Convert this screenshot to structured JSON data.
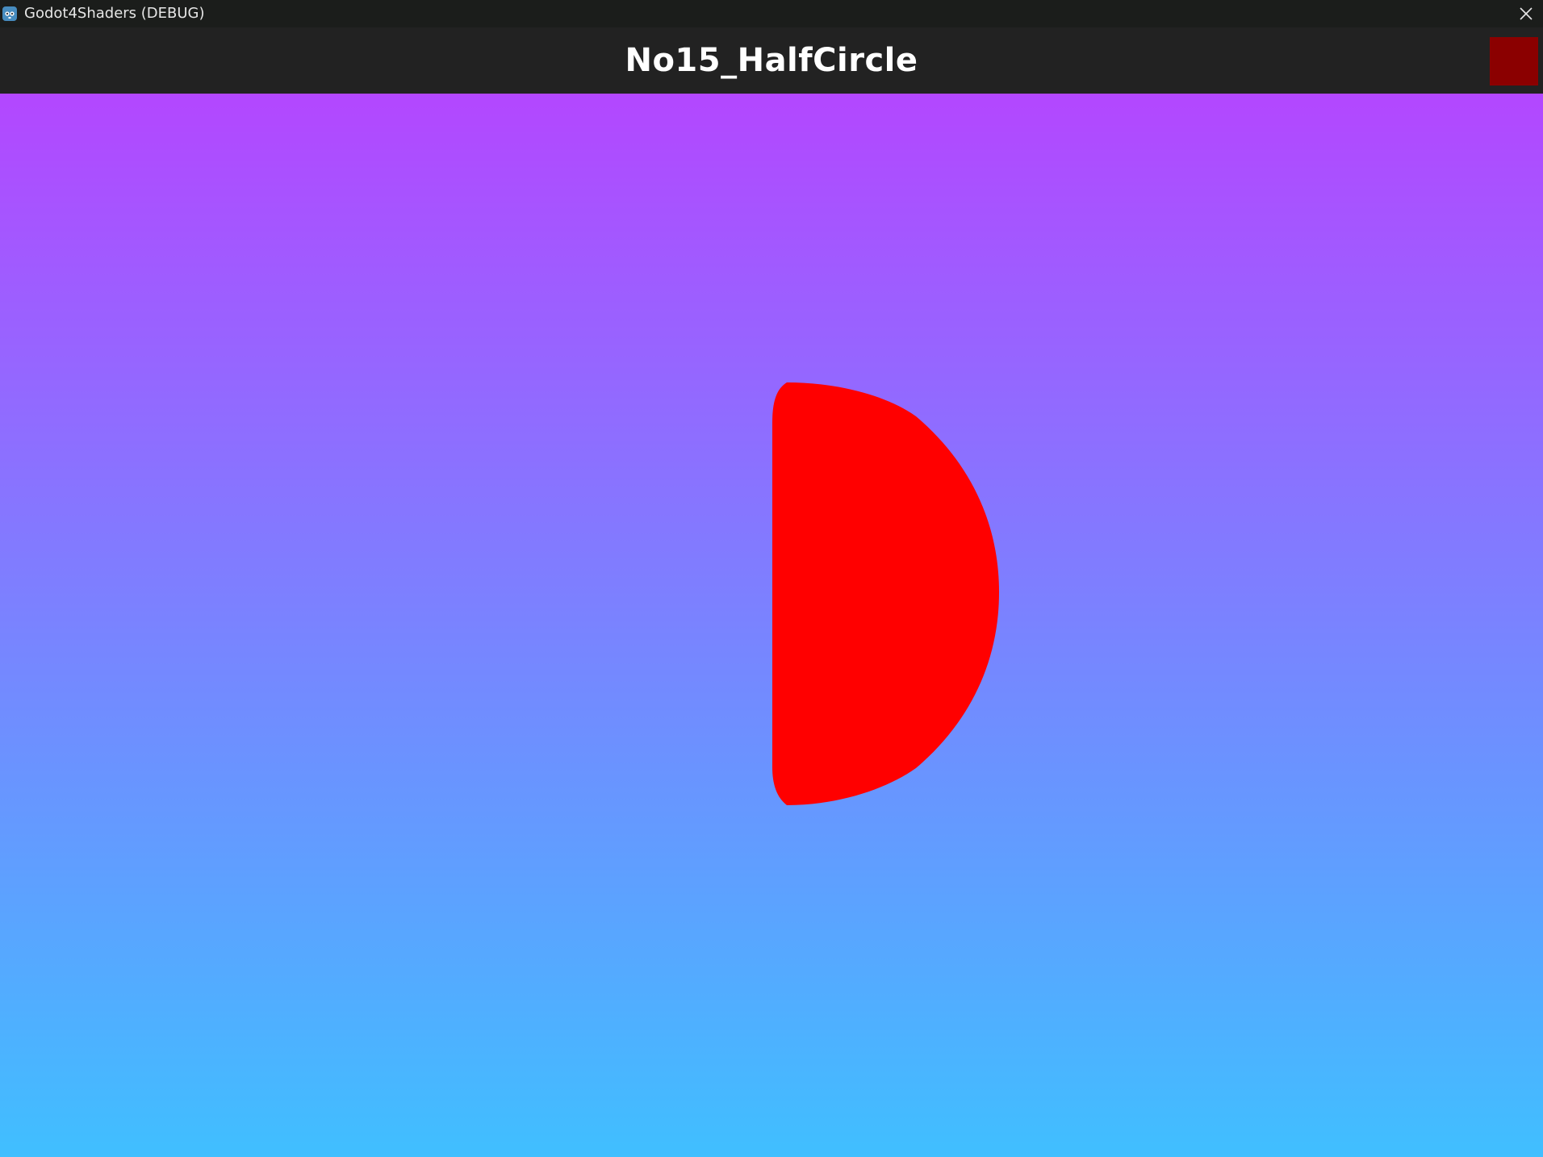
{
  "window": {
    "title": "Godot4Shaders (DEBUG)",
    "app_icon": "godot-icon",
    "close_icon": "close-icon"
  },
  "header": {
    "scene_title": "No15_HalfCircle",
    "swatch_color": "#8b0000"
  },
  "viewport": {
    "gradient_top": "#b347ff",
    "gradient_bottom": "#40bfff",
    "shape": "half-circle",
    "shape_color": "#ff0000"
  }
}
